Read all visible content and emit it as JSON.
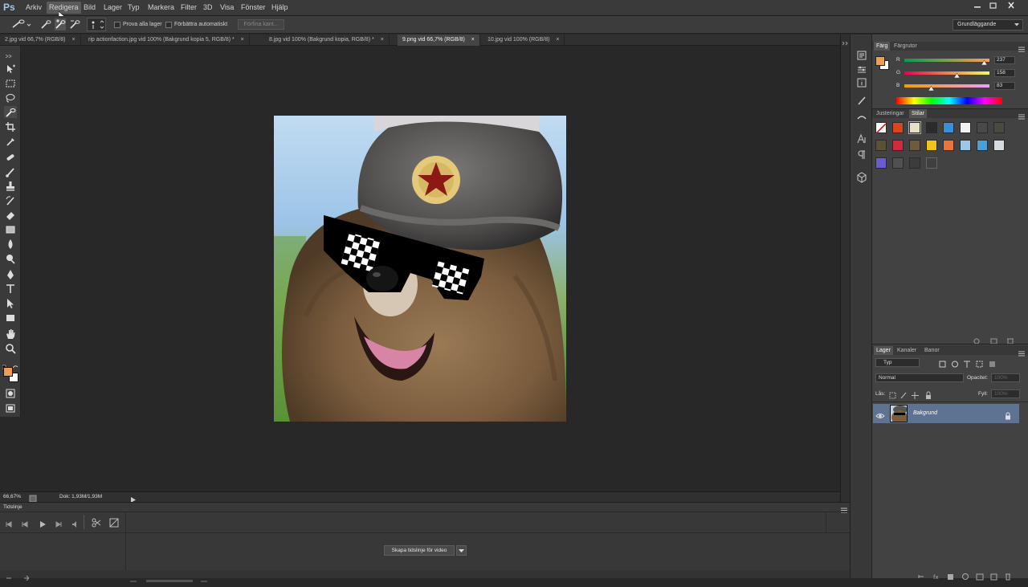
{
  "app": {
    "logo": "Ps",
    "menus": [
      "Arkiv",
      "Redigera",
      "Bild",
      "Lager",
      "Typ",
      "Markera",
      "Filter",
      "3D",
      "Visa",
      "Fönster",
      "Hjälp"
    ],
    "active_menu": "Redigera",
    "window_controls": [
      "minimize",
      "restore",
      "close"
    ]
  },
  "options_bar": {
    "sample_all_layers": "Prova alla lager",
    "auto_enhance": "Förbättra automatiskt",
    "refine_edge": "Förfina kant...",
    "workspace": "Grundläggande"
  },
  "tabs": [
    {
      "label": "2.jpg vid 66,7% (RGB/8)",
      "active": false
    },
    {
      "label": "rip actionfaction.jpg vid 100% (Bakgrund kopia 5, RGB/8) *",
      "active": false
    },
    {
      "label": "8.jpg vid 100% (Bakgrund kopia, RGB/8) *",
      "active": false
    },
    {
      "label": "9.png vid 66,7% (RGB/8)",
      "active": true
    },
    {
      "label": "10.jpg vid 100% (RGB/8)",
      "active": false
    }
  ],
  "tab_close_glyph": "×",
  "status": {
    "zoom": "66,67%",
    "doc": "Dok: 1,93M/1,93M"
  },
  "timeline": {
    "title": "Tidslinje",
    "create_button": "Skapa tidslinje för video"
  },
  "color_panel": {
    "tabs": [
      "Färg",
      "Färgrutor"
    ],
    "active_tab": "Färg",
    "channels": [
      {
        "label": "R",
        "value": "237"
      },
      {
        "label": "G",
        "value": "158"
      },
      {
        "label": "B",
        "value": "83"
      }
    ],
    "foreground": "#ed9e53",
    "background": "#ffffff"
  },
  "styles_panel": {
    "tabs": [
      "Justeringar",
      "Stilar"
    ],
    "active_tab": "Stilar"
  },
  "layers_panel": {
    "tabs": [
      "Lager",
      "Kanaler",
      "Banor"
    ],
    "active_tab": "Lager",
    "filter_kind": "Typ",
    "blend_mode": "Normal",
    "opacity_label": "Opacitet:",
    "opacity_value": "100%",
    "lock_label": "Lås:",
    "fill_label": "Fyll:",
    "fill_value": "100%",
    "layers": [
      {
        "name": "Bakgrund",
        "visible": true,
        "locked": true,
        "selected": true
      }
    ]
  }
}
